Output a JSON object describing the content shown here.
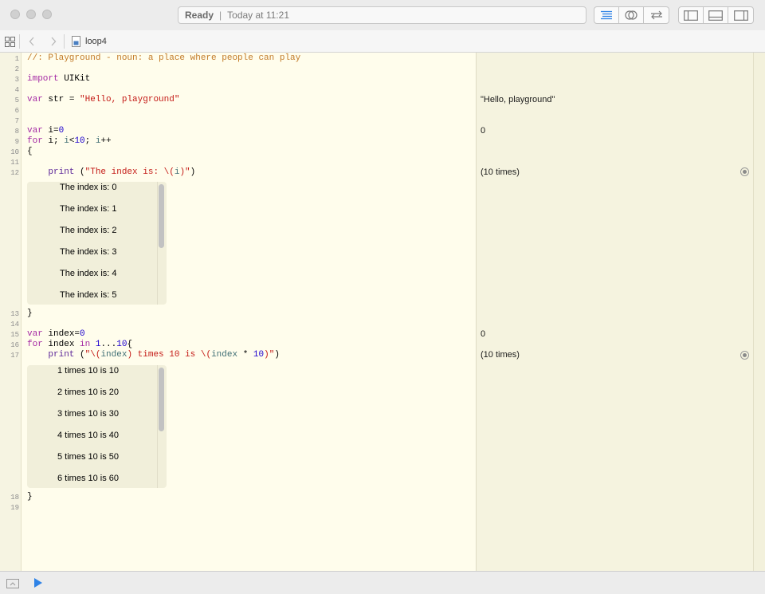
{
  "window": {
    "status": {
      "state": "Ready",
      "separator": "|",
      "time": "Today at 11:21"
    },
    "toolbar_icons": [
      "standard-editor-icon",
      "assistant-editor-icon",
      "version-editor-icon",
      "navigator-toggle-icon",
      "debug-area-toggle-icon",
      "utilities-toggle-icon"
    ]
  },
  "jumpbar": {
    "file_name": "loop4"
  },
  "code": {
    "line_numbers": [
      "1",
      "2",
      "3",
      "4",
      "5",
      "6",
      "7",
      "8",
      "9",
      "10",
      "11",
      "12",
      "13",
      "14",
      "15",
      "16",
      "17",
      "18",
      "19"
    ],
    "line1": "//: Playground - noun: a place where people can play",
    "line3_kw": "import",
    "line3_rest": " UIKit",
    "line5_kw": "var",
    "line5_mid": " str = ",
    "line5_str": "\"Hello, playground\"",
    "line8_kw": "var",
    "line8_mid": " i=",
    "line8_num": "0",
    "line9_kw": "for",
    "line9_a": " i; ",
    "line9_b": "i",
    "line9_c": "<",
    "line9_num": "10",
    "line9_d": "; ",
    "line9_e": "i",
    "line9_f": "++",
    "line10": "{",
    "line12_indent": "    ",
    "line12_fn": "print",
    "line12_a": " (",
    "line12_str1": "\"The index is: \\(",
    "line12_var": "i",
    "line12_str2": ")\"",
    "line12_b": ")",
    "line13": "}",
    "line15_kw": "var",
    "line15_mid": " index=",
    "line15_num": "0",
    "line16_kw": "for",
    "line16_a": " index ",
    "line16_kw2": "in",
    "line16_num1": " 1",
    "line16_op": "...",
    "line16_num2": "10",
    "line16_b": "{",
    "line17_indent": "    ",
    "line17_fn": "print",
    "line17_a": " (",
    "line17_str1": "\"\\(",
    "line17_var1": "index",
    "line17_str2": ") times 10 is \\(",
    "line17_var2": "index",
    "line17_op": " * ",
    "line17_num": "10",
    "line17_str3": ")\"",
    "line17_b": ")",
    "line18": "}"
  },
  "results": {
    "line5": "\"Hello, playground\"",
    "line8": "0",
    "line12": "(10 times)",
    "line15": "0",
    "line17": "(10 times)"
  },
  "console1": [
    "The index is: 0",
    "The index is: 1",
    "The index is: 2",
    "The index is: 3",
    "The index is: 4",
    "The index is: 5"
  ],
  "console2": [
    "1 times 10 is 10",
    "2 times 10 is 20",
    "3 times 10 is 30",
    "4 times 10 is 40",
    "5 times 10 is 50",
    "6 times 10 is 60"
  ],
  "colors": {
    "comment": "#c27a28",
    "keyword": "#a52aa4",
    "string": "#c41a16",
    "number": "#1c00cf",
    "variable": "#3f6e74",
    "function": "#5c2699",
    "accent": "#2f83e6"
  },
  "bottombar": {
    "icons": [
      "show-debug-area-icon",
      "run-icon"
    ]
  }
}
